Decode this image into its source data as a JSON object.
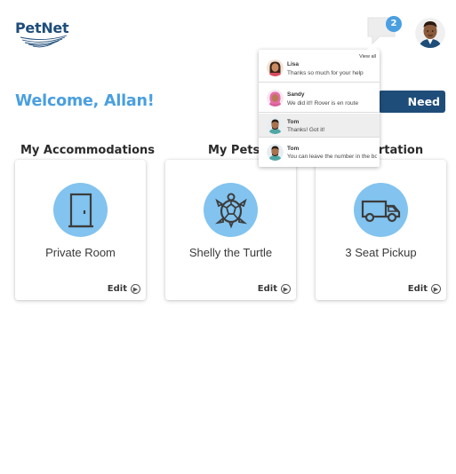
{
  "header": {
    "logo_text": "PetNet",
    "message_count": "2"
  },
  "welcome": "Welcome, Allan!",
  "help_button": "Need Help",
  "sections": [
    {
      "title": "My Accommodations",
      "card_label": "Private Room",
      "icon": "door-icon",
      "edit_label": "Edit"
    },
    {
      "title": "My Pets",
      "card_label": "Shelly the Turtle",
      "icon": "turtle-icon",
      "edit_label": "Edit"
    },
    {
      "title": "Transportation",
      "card_label": "3 Seat Pickup",
      "icon": "truck-icon",
      "edit_label": "Edit"
    }
  ],
  "messages": {
    "view_all": "View all",
    "items": [
      {
        "name": "Lisa",
        "text": "Thanks so much for your help",
        "read": false
      },
      {
        "name": "Sandy",
        "text": "We did it!! Rover is en route",
        "read": false
      },
      {
        "name": "Tom",
        "text": "Thanks! Got it!",
        "read": true
      },
      {
        "name": "Tom",
        "text": "You can leave the number in the box",
        "read": false
      }
    ]
  },
  "colors": {
    "accent": "#4a9fe0",
    "brand_dark": "#1f4d7a",
    "icon_circle": "#82c3ef"
  }
}
